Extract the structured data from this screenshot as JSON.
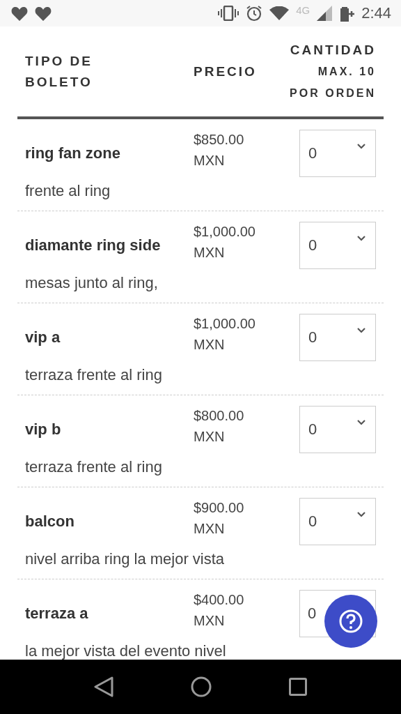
{
  "status_bar": {
    "network": "4G",
    "time": "2:44"
  },
  "table": {
    "columns": {
      "type": [
        "TIPO DE",
        "BOLETO"
      ],
      "price": "PRECIO",
      "quantity": [
        "CANTIDAD",
        "MAX. 10",
        "POR ORDEN"
      ]
    },
    "rows": [
      {
        "name": "ring fan zone",
        "price": [
          "$850.00",
          "MXN"
        ],
        "quantity": "0",
        "description": "frente al ring"
      },
      {
        "name": "diamante ring side",
        "price": [
          "$1,000.00",
          "MXN"
        ],
        "quantity": "0",
        "description": "mesas junto al ring,"
      },
      {
        "name": "vip a",
        "price": [
          "$1,000.00",
          "MXN"
        ],
        "quantity": "0",
        "description": "terraza frente al ring"
      },
      {
        "name": "vip b",
        "price": [
          "$800.00",
          "MXN"
        ],
        "quantity": "0",
        "description": "terraza frente al ring"
      },
      {
        "name": "balcon",
        "price": [
          "$900.00",
          "MXN"
        ],
        "quantity": "0",
        "description": "nivel arriba ring la mejor vista"
      },
      {
        "name": "terraza a",
        "price": [
          "$400.00",
          "MXN"
        ],
        "quantity": "0",
        "description": "la mejor vista del evento nivel"
      }
    ]
  }
}
